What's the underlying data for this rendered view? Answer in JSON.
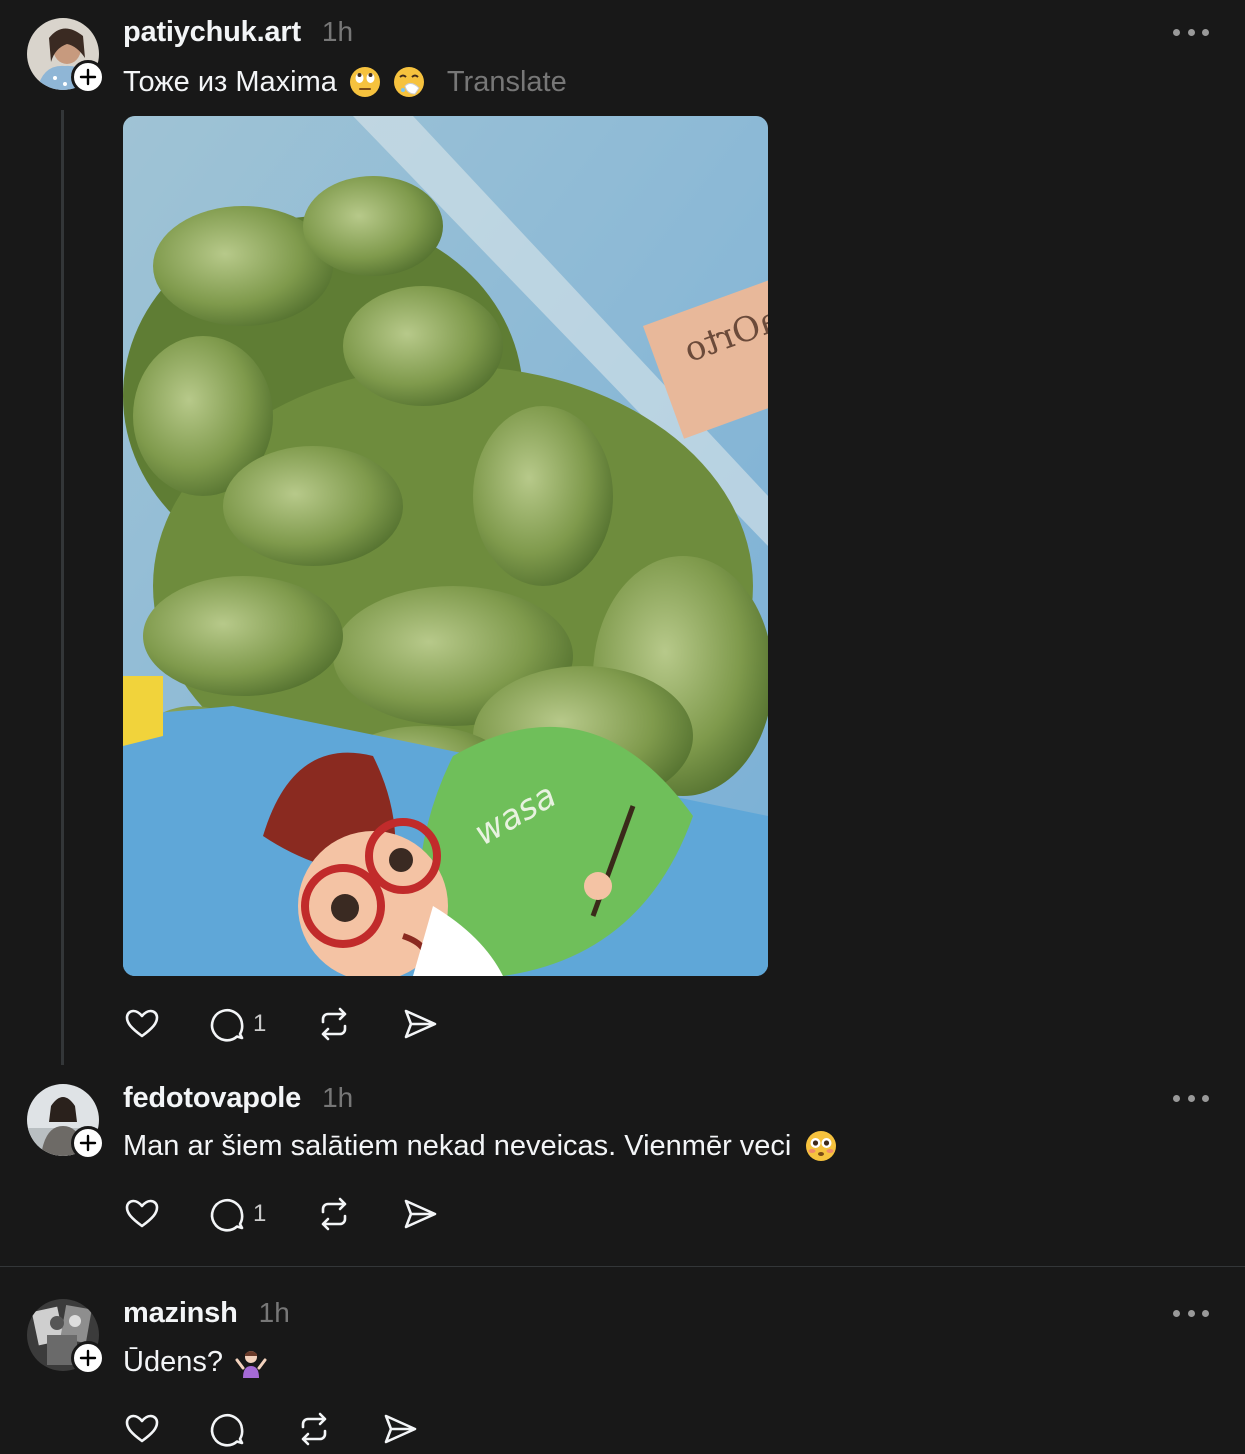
{
  "posts": [
    {
      "username": "patiychuk.art",
      "time": "1h",
      "text": "Тоже из Maxima",
      "emojis": [
        "face-with-rolling-eyes",
        "sneezing-face"
      ],
      "translate_label": "Translate",
      "replies_count": "1"
    },
    {
      "username": "fedotovapole",
      "time": "1h",
      "text": "Man ar šiem salātiem nekad neveicas. Vienmēr veci",
      "emojis": [
        "flushed-face"
      ],
      "replies_count": "1"
    },
    {
      "username": "mazinsh",
      "time": "1h",
      "text": "Ūdens?",
      "emojis": [
        "person-shrugging"
      ],
      "replies_count": ""
    }
  ],
  "colors": {
    "background": "#181818",
    "text_primary": "#f3f5f7",
    "text_secondary": "#777777",
    "divider": "#333638"
  },
  "icons": [
    "like-icon",
    "reply-icon",
    "repost-icon",
    "share-icon",
    "more-icon",
    "follow-plus-icon"
  ]
}
